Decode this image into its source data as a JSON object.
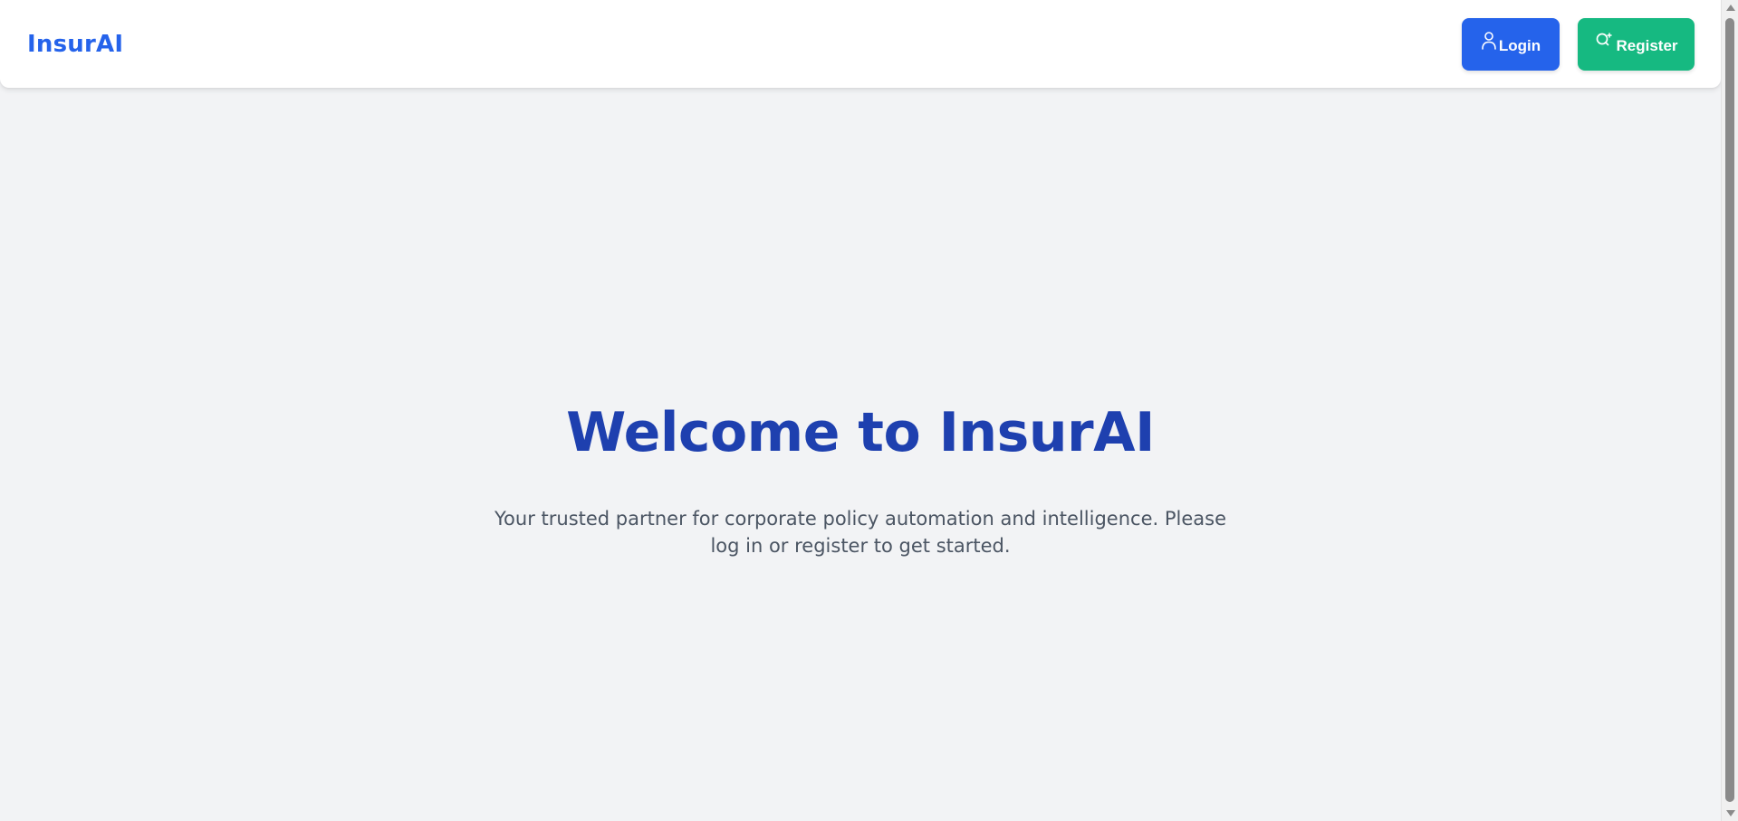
{
  "header": {
    "brand": "InsurAI",
    "login_label": "Login",
    "register_label": "Register",
    "login_icon": "user-icon",
    "register_icon": "user-plus-icon"
  },
  "hero": {
    "title": "Welcome to InsurAI",
    "subtitle": "Your trusted partner for corporate policy automation and intelligence. Please log in or register to get started."
  },
  "colors": {
    "brand_blue": "#2563eb",
    "title_blue": "#1e40af",
    "register_green": "#16b981",
    "background": "#f2f3f5",
    "subtitle_gray": "#4b5563"
  }
}
